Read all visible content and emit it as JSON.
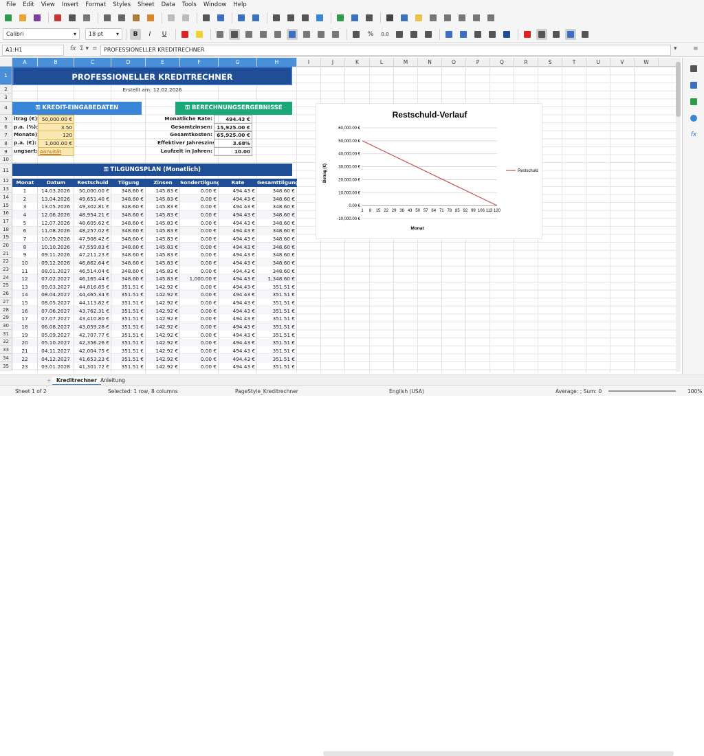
{
  "menu": [
    "File",
    "Edit",
    "View",
    "Insert",
    "Format",
    "Styles",
    "Sheet",
    "Data",
    "Tools",
    "Window",
    "Help"
  ],
  "font": {
    "name": "Calibri",
    "size": "18 pt"
  },
  "namebox": "A1:H1",
  "formula": "PROFESSIONELLER KREDITRECHNER",
  "columns": [
    "A",
    "B",
    "C",
    "D",
    "E",
    "F",
    "G",
    "H",
    "I",
    "J",
    "K",
    "L",
    "M",
    "N",
    "O",
    "P",
    "Q",
    "R",
    "S",
    "T",
    "U",
    "V",
    "W"
  ],
  "title": "PROFESSIONELLER KREDITRECHNER",
  "created": "Erstellt am: 12.02.2026",
  "input_header": "⚿ KREDIT-EINGABEDATEN",
  "result_header": "⚿ BERECHNUNGSERGEBNISSE",
  "plan_header": "⚿ TILGUNGSPLAN (Monatlich)",
  "inputs": [
    {
      "label": "itrag (€):",
      "value": "50,000.00 €"
    },
    {
      "label": "p.a. (%):",
      "value": "3.50"
    },
    {
      "label": "Monate):",
      "value": "120"
    },
    {
      "label": "p.a. (€):",
      "value": "1,000.00 €"
    },
    {
      "label": "ungsart:",
      "value": "Annuität"
    }
  ],
  "results": [
    {
      "label": "Monatliche Rate:",
      "value": "494.43 €"
    },
    {
      "label": "Gesamtzinsen:",
      "value": "15,925.00 €"
    },
    {
      "label": "Gesamtkosten:",
      "value": "65,925.00 €"
    },
    {
      "label": "Effektiver Jahreszins:",
      "value": "3.68%"
    },
    {
      "label": "Laufzeit in Jahren:",
      "value": "10.00"
    }
  ],
  "table_headers": [
    "Monat",
    "Datum",
    "Restschuld",
    "Tilgung",
    "Zinsen",
    "Sondertilgung",
    "Rate",
    "Gesamttilgung"
  ],
  "table_rows": [
    [
      "1",
      "14.03.2026",
      "50,000.00 €",
      "348.60 €",
      "145.83 €",
      "0.00 €",
      "494.43 €",
      "348.60 €"
    ],
    [
      "2",
      "13.04.2026",
      "49,651.40 €",
      "348.60 €",
      "145.83 €",
      "0.00 €",
      "494.43 €",
      "348.60 €"
    ],
    [
      "3",
      "13.05.2026",
      "49,302.81 €",
      "348.60 €",
      "145.83 €",
      "0.00 €",
      "494.43 €",
      "348.60 €"
    ],
    [
      "4",
      "12.06.2026",
      "48,954.21 €",
      "348.60 €",
      "145.83 €",
      "0.00 €",
      "494.43 €",
      "348.60 €"
    ],
    [
      "5",
      "12.07.2026",
      "48,605.62 €",
      "348.60 €",
      "145.83 €",
      "0.00 €",
      "494.43 €",
      "348.60 €"
    ],
    [
      "6",
      "11.08.2026",
      "48,257.02 €",
      "348.60 €",
      "145.83 €",
      "0.00 €",
      "494.43 €",
      "348.60 €"
    ],
    [
      "7",
      "10.09.2026",
      "47,908.42 €",
      "348.60 €",
      "145.83 €",
      "0.00 €",
      "494.43 €",
      "348.60 €"
    ],
    [
      "8",
      "10.10.2026",
      "47,559.83 €",
      "348.60 €",
      "145.83 €",
      "0.00 €",
      "494.43 €",
      "348.60 €"
    ],
    [
      "9",
      "09.11.2026",
      "47,211.23 €",
      "348.60 €",
      "145.83 €",
      "0.00 €",
      "494.43 €",
      "348.60 €"
    ],
    [
      "10",
      "09.12.2026",
      "46,862.64 €",
      "348.60 €",
      "145.83 €",
      "0.00 €",
      "494.43 €",
      "348.60 €"
    ],
    [
      "11",
      "08.01.2027",
      "46,514.04 €",
      "348.60 €",
      "145.83 €",
      "0.00 €",
      "494.43 €",
      "348.60 €"
    ],
    [
      "12",
      "07.02.2027",
      "46,165.44 €",
      "348.60 €",
      "145.83 €",
      "1,000.00 €",
      "494.43 €",
      "1,348.60 €"
    ],
    [
      "13",
      "09.03.2027",
      "44,816.85 €",
      "351.51 €",
      "142.92 €",
      "0.00 €",
      "494.43 €",
      "351.51 €"
    ],
    [
      "14",
      "08.04.2027",
      "44,465.34 €",
      "351.51 €",
      "142.92 €",
      "0.00 €",
      "494.43 €",
      "351.51 €"
    ],
    [
      "15",
      "08.05.2027",
      "44,113.82 €",
      "351.51 €",
      "142.92 €",
      "0.00 €",
      "494.43 €",
      "351.51 €"
    ],
    [
      "16",
      "07.06.2027",
      "43,762.31 €",
      "351.51 €",
      "142.92 €",
      "0.00 €",
      "494.43 €",
      "351.51 €"
    ],
    [
      "17",
      "07.07.2027",
      "43,410.80 €",
      "351.51 €",
      "142.92 €",
      "0.00 €",
      "494.43 €",
      "351.51 €"
    ],
    [
      "18",
      "06.08.2027",
      "43,059.28 €",
      "351.51 €",
      "142.92 €",
      "0.00 €",
      "494.43 €",
      "351.51 €"
    ],
    [
      "19",
      "05.09.2027",
      "42,707.77 €",
      "351.51 €",
      "142.92 €",
      "0.00 €",
      "494.43 €",
      "351.51 €"
    ],
    [
      "20",
      "05.10.2027",
      "42,356.26 €",
      "351.51 €",
      "142.92 €",
      "0.00 €",
      "494.43 €",
      "351.51 €"
    ],
    [
      "21",
      "04.11.2027",
      "42,004.75 €",
      "351.51 €",
      "142.92 €",
      "0.00 €",
      "494.43 €",
      "351.51 €"
    ],
    [
      "22",
      "04.12.2027",
      "41,653.23 €",
      "351.51 €",
      "142.92 €",
      "0.00 €",
      "494.43 €",
      "351.51 €"
    ],
    [
      "23",
      "03.01.2028",
      "41,301.72 €",
      "351.51 €",
      "142.92 €",
      "0.00 €",
      "494.43 €",
      "351.51 €"
    ]
  ],
  "chart_data": {
    "type": "line",
    "title": "Restschuld-Verlauf",
    "xlabel": "Monat",
    "ylabel": "Betrag (€)",
    "yticks": [
      "60,000.00 €",
      "50,000.00 €",
      "40,000.00 €",
      "30,000.00 €",
      "20,000.00 €",
      "10,000.00 €",
      "0.00 €",
      "-10,000.00 €"
    ],
    "xticks": [
      "1",
      "8",
      "15",
      "22",
      "29",
      "36",
      "43",
      "50",
      "57",
      "64",
      "71",
      "78",
      "85",
      "92",
      "99",
      "106",
      "113",
      "120"
    ],
    "ylim": [
      -10000,
      60000
    ],
    "series": [
      {
        "name": "Restschuld",
        "color": "#c0504d",
        "x": [
          1,
          120
        ],
        "values": [
          50000,
          0
        ]
      }
    ],
    "legend": "right"
  },
  "tabs": [
    "Kreditrechner",
    "Anleitung"
  ],
  "status": {
    "sheet": "Sheet 1 of 2",
    "selected": "Selected: 1 row, 8 columns",
    "pagestyle": "PageStyle_Kreditrechner",
    "lang": "English (USA)",
    "sum": "Average: ; Sum: 0",
    "zoom": "100%"
  },
  "colors": {
    "title_bg": "#1f4e96",
    "input_bg": "#3a85d8",
    "result_bg": "#1aa87a",
    "input_fill": "#fbe8b0"
  }
}
